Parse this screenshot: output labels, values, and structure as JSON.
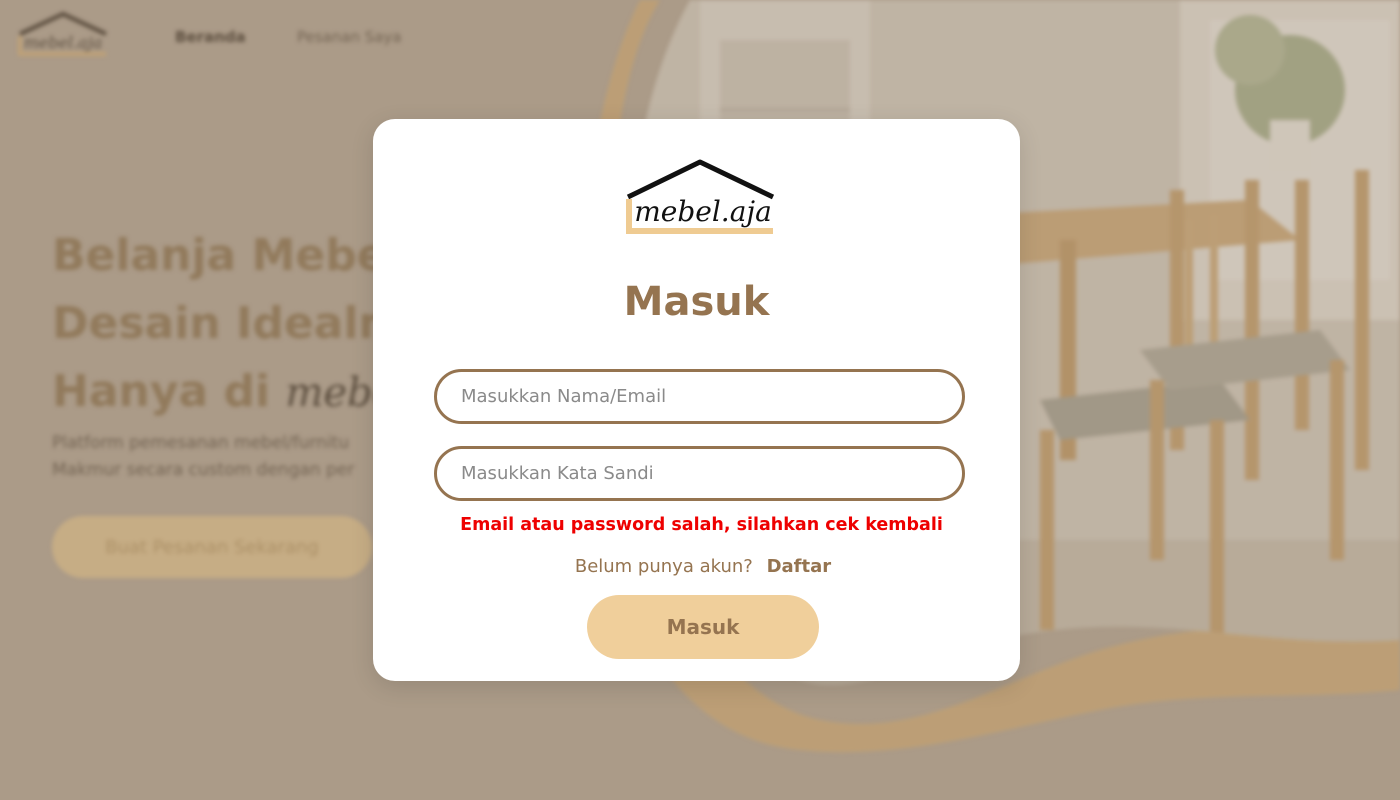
{
  "colors": {
    "accent_brown": "#957450",
    "button_beige": "#f0cf9b",
    "error_red": "#ee0000",
    "modal_bg": "#ffffff"
  },
  "background": {
    "logo_text": "mebel.aja",
    "nav": {
      "home": "Beranda",
      "orders": "Pesanan Saya"
    },
    "hero": {
      "line1": "Belanja Mebel",
      "line2": "Desain Idealm",
      "line3_prefix": "Hanya di",
      "line3_script": "mebel",
      "desc_line1": "Platform pemesanan mebel/furnitu",
      "desc_line2": "Makmur secara custom dengan per",
      "cta": "Buat Pesanan Sekarang"
    }
  },
  "modal": {
    "logo_text": "mebel.aja",
    "title": "Masuk",
    "email_placeholder": "Masukkan Nama/Email",
    "password_placeholder": "Masukkan Kata Sandi",
    "error": "Email atau password salah, silahkan cek kembali",
    "register_prompt": "Belum punya akun?",
    "register_link": "Daftar",
    "submit": "Masuk"
  }
}
